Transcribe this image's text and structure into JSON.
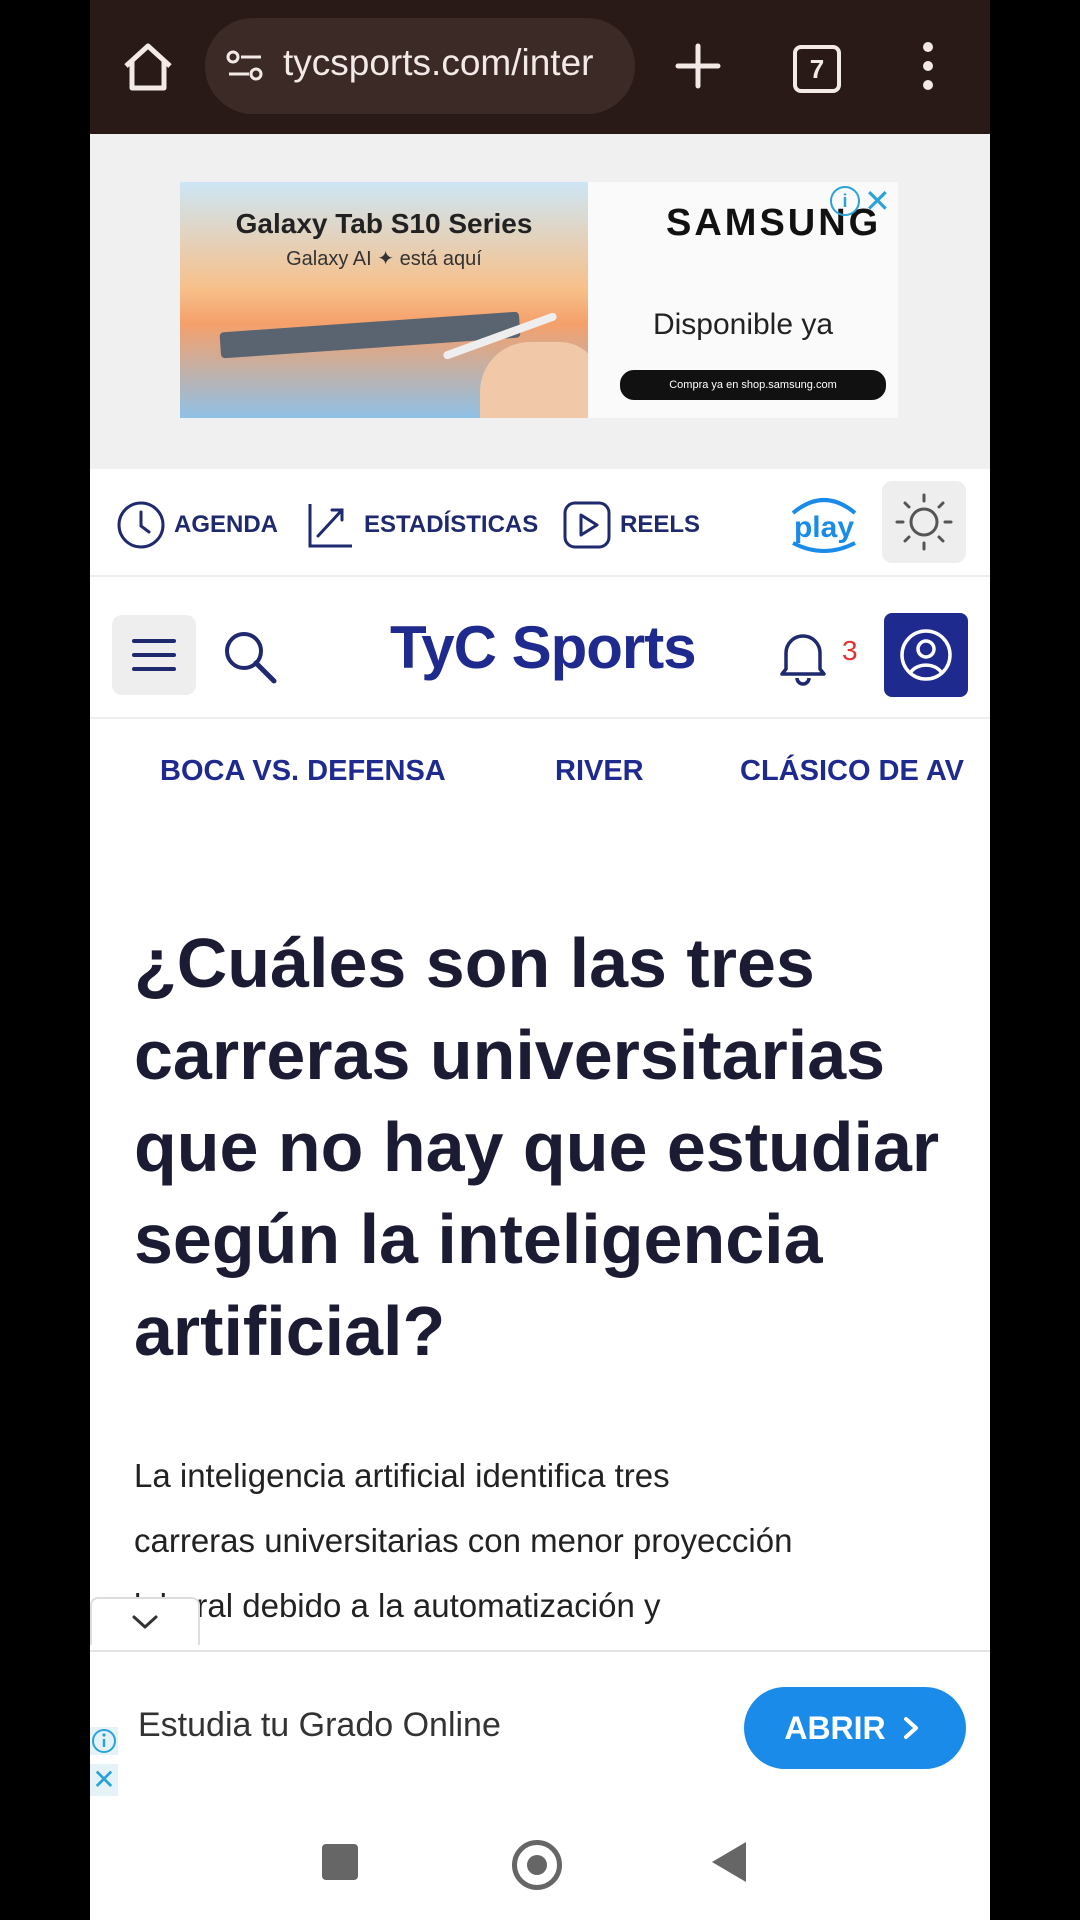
{
  "browser": {
    "url": "tycsports.com/inter",
    "tab_count": "7"
  },
  "top_ad": {
    "title": "Galaxy Tab S10 Series",
    "subtitle": "Galaxy AI ✦ está aquí",
    "brand": "SAMSUNG",
    "cta": "Disponible ya",
    "shop_text": "Compra ya en  shop.samsung.com"
  },
  "quick_nav": {
    "items": [
      {
        "label": "AGENDA"
      },
      {
        "label": "ESTADÍSTICAS"
      },
      {
        "label": "REELS"
      }
    ],
    "play_label": "play"
  },
  "header": {
    "logo": "TyC Sports",
    "notification_count": "3"
  },
  "topics": [
    "BOCA VS. DEFENSA",
    "RIVER",
    "CLÁSICO DE AV"
  ],
  "article": {
    "headline": "¿Cuáles son las tres carreras universitarias que no hay que estudiar según la inteligencia artificial?",
    "lead_line1": "La inteligencia artificial identifica tres",
    "lead_line2": "carreras universitarias con menor proyección",
    "lead_line3": "laboral debido a la automatización y"
  },
  "bottom_ad": {
    "text": "Estudia tu Grado Online",
    "button": "ABRIR"
  },
  "colors": {
    "brand_blue": "#1f2a8e",
    "browser_bar": "#2a1a17",
    "cta_blue": "#1a8be8"
  }
}
